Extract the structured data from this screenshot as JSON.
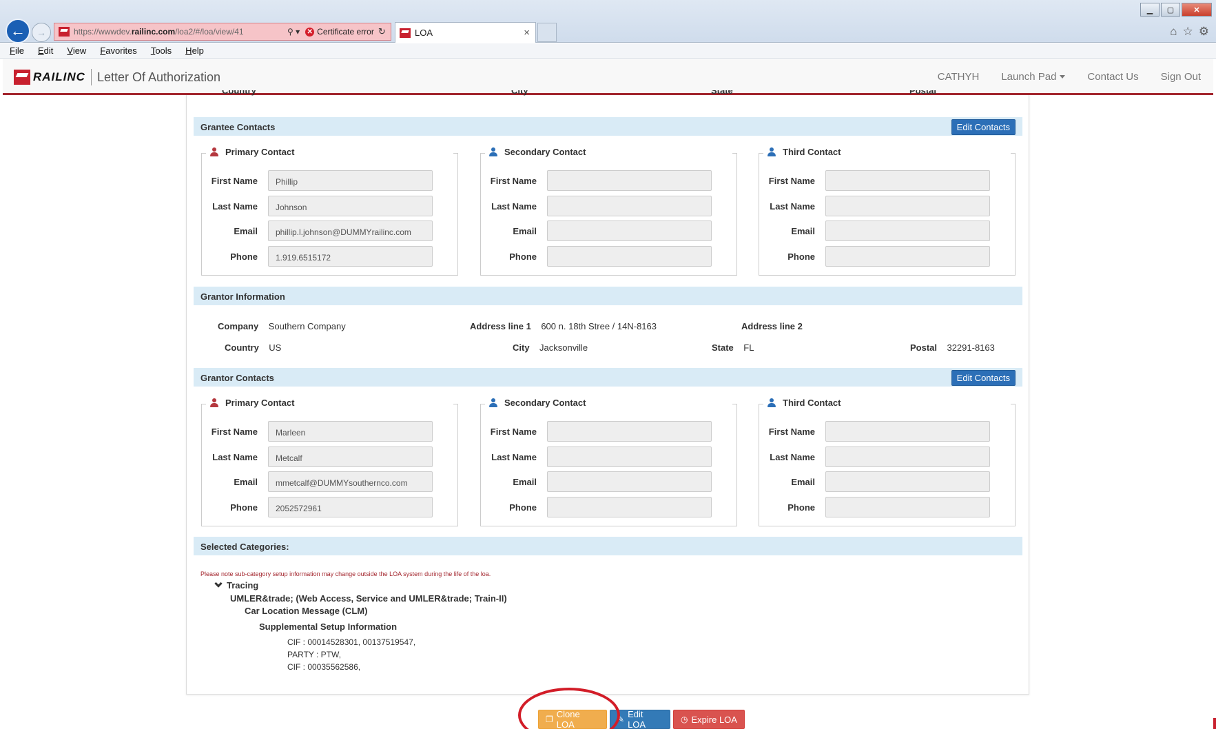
{
  "browser": {
    "url_prefix": "https://wwwdev.",
    "url_domain": "railinc.com",
    "url_suffix": "/loa2/#/loa/view/41",
    "search_glyph": "⚲ ▾",
    "cert_error": "Certificate error",
    "tab_title": "LOA",
    "menu": [
      "File",
      "Edit",
      "View",
      "Favorites",
      "Tools",
      "Help"
    ]
  },
  "header": {
    "brand": "RAILINC",
    "app_title": "Letter Of Authorization",
    "nav": {
      "user": "CATHYH",
      "launch_pad": "Launch Pad",
      "contact_us": "Contact Us",
      "sign_out": "Sign Out"
    }
  },
  "cut_row": {
    "country": "Country",
    "city": "City",
    "state": "State",
    "postal": "Postal"
  },
  "labels": {
    "first_name": "First Name",
    "last_name": "Last Name",
    "email": "Email",
    "phone": "Phone",
    "primary": "Primary Contact",
    "secondary": "Secondary Contact",
    "third": "Third Contact",
    "edit_contacts": "Edit Contacts"
  },
  "grantee_contacts": {
    "title": "Grantee Contacts",
    "primary": {
      "first_name": "Phillip",
      "last_name": "Johnson",
      "email": "phillip.l.johnson@DUMMYrailinc.com",
      "phone": "1.919.6515172"
    }
  },
  "grantor_info": {
    "title": "Grantor Information",
    "company_label": "Company",
    "company": "Southern Company",
    "address1_label": "Address line 1",
    "address1": "600 n. 18th Stree / 14N-8163",
    "address2_label": "Address line 2",
    "country_label": "Country",
    "country": "US",
    "city_label": "City",
    "city": "Jacksonville",
    "state_label": "State",
    "state": "FL",
    "postal_label": "Postal",
    "postal": "32291-8163"
  },
  "grantor_contacts": {
    "title": "Grantor Contacts",
    "primary": {
      "first_name": "Marleen",
      "last_name": "Metcalf",
      "email": "mmetcalf@DUMMYsouthernco.com",
      "phone": "2052572961"
    }
  },
  "categories": {
    "title": "Selected Categories:",
    "note": "Please note sub-category setup information may change outside the LOA system during the life of the loa.",
    "tracing": "Tracing",
    "umler": "UMLER&trade; (Web Access, Service and UMLER&trade; Train-II)",
    "clm": "Car Location Message (CLM)",
    "supplemental": "Supplemental Setup Information",
    "lines": [
      "CIF : 00014528301, 00137519547,",
      "PARTY : PTW,",
      "CIF : 00035562586,"
    ]
  },
  "actions": {
    "clone": "Clone LOA",
    "edit": "Edit LOA",
    "expire": "Expire LOA"
  },
  "colors": {
    "brand_red": "#a3262e",
    "primary_blue": "#2c6fb7",
    "section_bg": "#d9ebf6",
    "clone_orange": "#f0ad4e",
    "expire_red": "#d9534f"
  }
}
